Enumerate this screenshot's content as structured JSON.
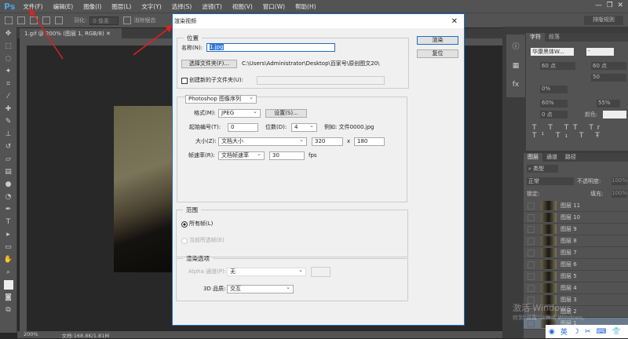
{
  "app": {
    "logo": "Ps"
  },
  "menu": [
    "文件(F)",
    "编辑(E)",
    "图像(I)",
    "图层(L)",
    "文字(Y)",
    "选择(S)",
    "滤镜(T)",
    "视图(V)",
    "窗口(W)",
    "帮助(H)"
  ],
  "options": {
    "feather_label": "羽化:",
    "feather_value": "0 像素",
    "antialias": "消除锯齿",
    "workspace": "排版规则"
  },
  "document": {
    "tab": "1.gif @ 200% (图层 1, RGB/8)",
    "zoom": "200%",
    "doc_size": "文档:168.8K/1.81M"
  },
  "dialog": {
    "title": "渲染视频",
    "close": "✕",
    "location": {
      "legend": "位置",
      "name_label": "名称(N):",
      "name_value": "1.jpg",
      "choose_folder": "选择文件夹(F)...",
      "path": "C:\\Users\\Administrator\\Desktop\\百家号\\原创图文20\\",
      "subfolder_label": "创建新的子文件夹(U):",
      "subfolder_value": ""
    },
    "render_button": "渲染",
    "reset_button": "复位",
    "export": {
      "type": "Photoshop 图像序列",
      "format_label": "格式(M):",
      "format": "JPEG",
      "settings": "设置(S)...",
      "start_label": "起始编号(T):",
      "start": "0",
      "digits_label": "位数(D):",
      "digits": "4",
      "example": "例如: 文件0000.jpg",
      "size_label": "大小(Z):",
      "size": "文档大小",
      "width": "320",
      "x": "x",
      "height": "180",
      "fps_label": "帧速率(R):",
      "fps_mode": "文档帧速率",
      "fps": "30",
      "fps_unit": "fps"
    },
    "range": {
      "legend": "范围",
      "all": "所有帧(L)",
      "current": "当前所选帧(E)",
      "selected": "all"
    },
    "render_options": {
      "legend": "渲染选项",
      "alpha_label": "Alpha 通道(P):",
      "alpha": "无",
      "quality_label": "3D 品质:",
      "quality": "交互"
    }
  },
  "character": {
    "tabs": [
      "字符",
      "段落"
    ],
    "font": "华康黑体W...",
    "style": "-",
    "size": "60 点",
    "leading": "60 点",
    "tracking": "50",
    "scale": "0%",
    "vscale": "60%",
    "hscale": "55%",
    "baseline": "0 点",
    "color_label": "颜色:"
  },
  "layers": {
    "tabs": [
      "图层",
      "通道",
      "路径"
    ],
    "filter": "类型",
    "blend": "正常",
    "opacity_label": "不透明度:",
    "opacity": "100%",
    "lock_label": "锁定:",
    "fill_label": "填充:",
    "fill": "100%",
    "items": [
      "图层 11",
      "图层 10",
      "图层 9",
      "图层 8",
      "图层 7",
      "图层 6",
      "图层 5",
      "图层 4",
      "图层 3",
      "图层 2",
      "图层 1"
    ]
  },
  "watermark": {
    "line1": "激活 Windows",
    "line2": "转到\"设置\"以激活 Windows。"
  },
  "ime": {
    "lang": "英"
  },
  "colors": {
    "annotation": "#e02020",
    "accent": "#1e6fc4"
  }
}
